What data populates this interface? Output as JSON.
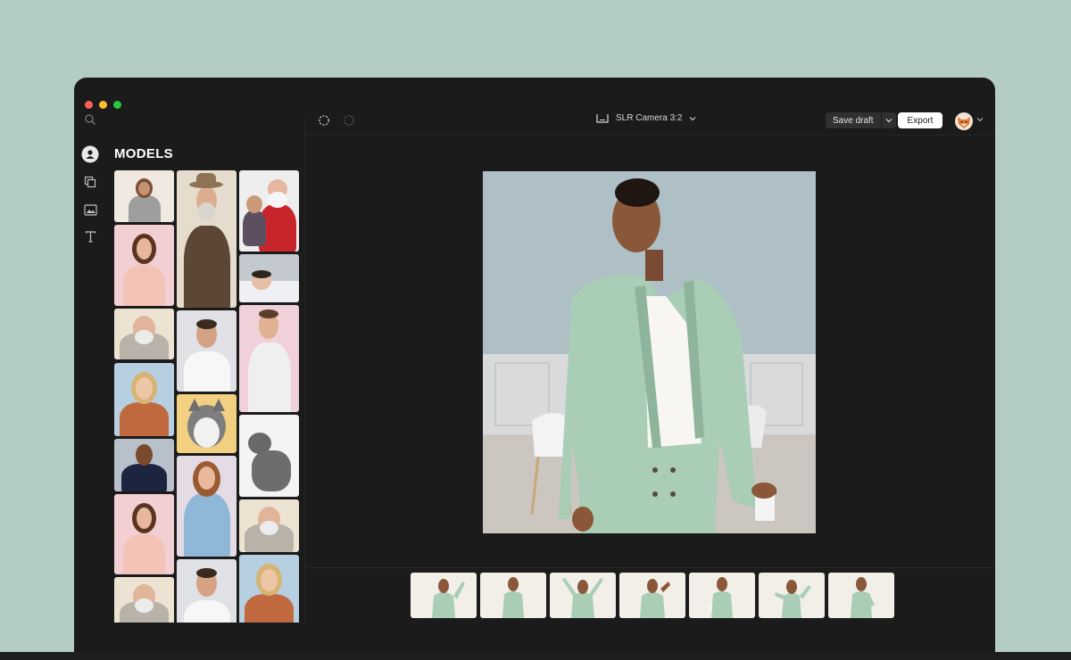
{
  "app": {
    "panel_title": "MODELS"
  },
  "toolbar": {
    "camera_label": "SLR Camera 3:2",
    "save_label": "Save draft",
    "export_label": "Export"
  },
  "rail": {
    "items": [
      "models-icon",
      "templates-icon",
      "image-icon",
      "text-icon"
    ]
  },
  "colors": {
    "window_bg": "#1b1b1b",
    "desktop_bg": "#b3cdc6",
    "accent_export": "#ffffff",
    "suit": "#a9cdb5"
  },
  "models": [
    {
      "id": "woman-bob"
    },
    {
      "id": "man-fedora"
    },
    {
      "id": "santa-child"
    },
    {
      "id": "woman-pink"
    },
    {
      "id": "baby-sleeping"
    },
    {
      "id": "man-beard-glasses"
    },
    {
      "id": "man-white-shirt"
    },
    {
      "id": "man-tattoo"
    },
    {
      "id": "woman-blonde"
    },
    {
      "id": "husky-dog"
    },
    {
      "id": "gray-cat"
    },
    {
      "id": "man-tuxedo"
    },
    {
      "id": "woman-denim"
    },
    {
      "id": "woman-pink-2"
    },
    {
      "id": "man-beard-glasses-2"
    },
    {
      "id": "man-beard-glasses-3"
    },
    {
      "id": "man-white-shirt-2"
    },
    {
      "id": "woman-blonde-2"
    }
  ],
  "poses": [
    {
      "id": "pose-1"
    },
    {
      "id": "pose-2"
    },
    {
      "id": "pose-3"
    },
    {
      "id": "pose-4"
    },
    {
      "id": "pose-5"
    },
    {
      "id": "pose-6"
    },
    {
      "id": "pose-7"
    }
  ]
}
